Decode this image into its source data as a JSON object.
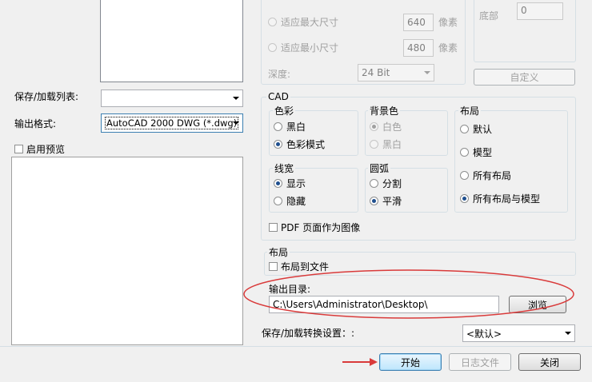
{
  "left": {
    "save_load_list_label": "保存/加载列表:",
    "save_load_list_value": "",
    "output_format_label": "输出格式:",
    "output_format_value": "AutoCAD 2000 DWG (*.dwg)",
    "enable_preview_label": "启用预览"
  },
  "size": {
    "fit_max_label": "适应最大尺寸",
    "fit_max_value": "640",
    "fit_min_label": "适应最小尺寸",
    "fit_min_value": "480",
    "unit": "像素",
    "depth_label": "深度:",
    "depth_value": "24 Bit"
  },
  "margins": {
    "bottom_label": "底部",
    "bottom_value": "0",
    "custom_button": "自定义"
  },
  "cad": {
    "title": "CAD",
    "color": {
      "title": "色彩",
      "options": [
        "黑白",
        "色彩模式"
      ]
    },
    "background": {
      "title": "背景色",
      "options": [
        "白色",
        "黑白"
      ]
    },
    "layout": {
      "title": "布局",
      "options": [
        "默认",
        "模型",
        "所有布局",
        "所有布局与模型"
      ]
    },
    "lineweight": {
      "title": "线宽",
      "options": [
        "显示",
        "隐藏"
      ]
    },
    "arc": {
      "title": "圆弧",
      "options": [
        "分割",
        "平滑"
      ]
    },
    "pdf_as_image": "PDF 页面作为图像"
  },
  "layout_box": {
    "title": "布局",
    "layout_to_file": "布局到文件"
  },
  "output": {
    "dir_label": "输出目录:",
    "dir_value": "C:\\Users\\Administrator\\Desktop\\",
    "browse_button": "浏览"
  },
  "settings": {
    "label": "保存/加载转换设置：:",
    "value": "<默认>"
  },
  "footer": {
    "start_button": "开始",
    "log_button": "日志文件",
    "close_button": "关闭"
  },
  "colors": {
    "annotation_red": "#d93a3a",
    "dialog_bg": "#f0f0f0"
  }
}
